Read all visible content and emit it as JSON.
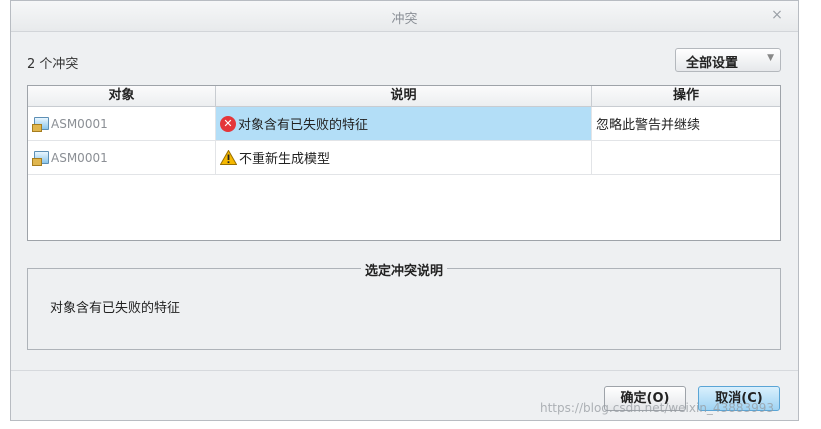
{
  "window": {
    "title": "冲突",
    "close_glyph": "×"
  },
  "conflict_count": "2 个冲突",
  "set_all": {
    "label": "全部设置",
    "arrow": "▼"
  },
  "table": {
    "headers": [
      "对象",
      "说明",
      "操作"
    ],
    "rows": [
      {
        "object": "ASM0001",
        "object_icon": "assembly-icon",
        "description": "对象含有已失败的特征",
        "status_icon": "error-icon",
        "action": "忽略此警告并继续",
        "selected": true
      },
      {
        "object": "ASM0001",
        "object_icon": "assembly-icon",
        "description": "不重新生成模型",
        "status_icon": "warning-icon",
        "action": "",
        "selected": false
      }
    ]
  },
  "details": {
    "title": "选定冲突说明",
    "text": "对象含有已失败的特征"
  },
  "buttons": {
    "ok": "确定(O)",
    "cancel": "取消(C)"
  },
  "watermark": "https://blog.csdn.net/weixin_43883993",
  "colors": {
    "selection": "#b3def7",
    "error": "#e4363a",
    "warning": "#f5b800",
    "cancel_accent": "#9fd3f3"
  }
}
